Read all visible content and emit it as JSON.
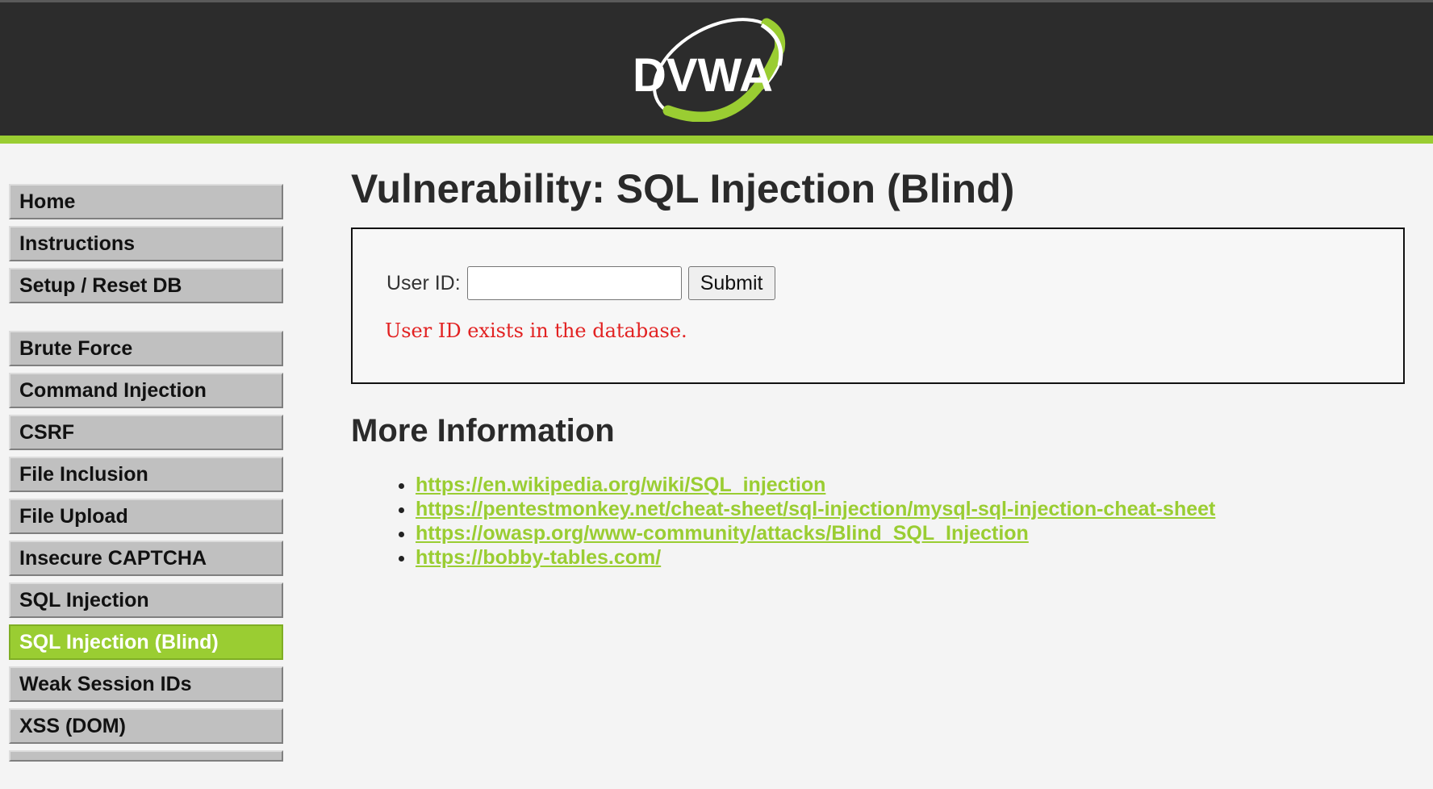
{
  "header": {
    "logo_text": "DVWA",
    "brand_color": "#9acd32",
    "background_color": "#2c2c2c"
  },
  "sidebar": {
    "groups": [
      {
        "items": [
          "Home",
          "Instructions",
          "Setup / Reset DB"
        ]
      },
      {
        "items": [
          "Brute Force",
          "Command Injection",
          "CSRF",
          "File Inclusion",
          "File Upload",
          "Insecure CAPTCHA",
          "SQL Injection",
          "SQL Injection (Blind)",
          "Weak Session IDs",
          "XSS (DOM)"
        ]
      }
    ],
    "selected": "SQL Injection (Blind)"
  },
  "main": {
    "title": "Vulnerability: SQL Injection (Blind)",
    "form": {
      "label": "User ID:",
      "input_value": "",
      "submit_label": "Submit",
      "result_message": "User ID exists in the database.",
      "result_color": "#e22222"
    },
    "more_info": {
      "heading": "More Information",
      "links": [
        "https://en.wikipedia.org/wiki/SQL_injection",
        "https://pentestmonkey.net/cheat-sheet/sql-injection/mysql-sql-injection-cheat-sheet",
        "https://owasp.org/www-community/attacks/Blind_SQL_Injection",
        "https://bobby-tables.com/"
      ]
    }
  }
}
